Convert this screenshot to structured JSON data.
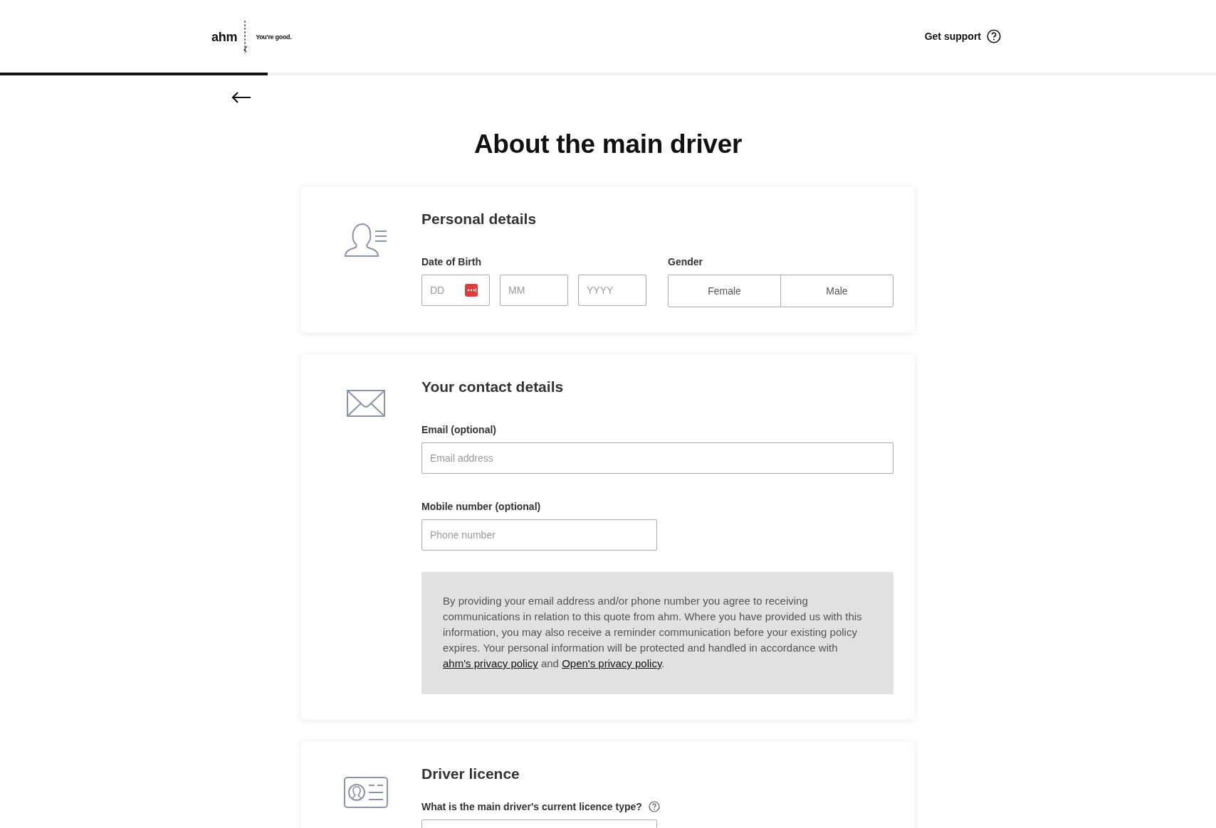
{
  "header": {
    "logo": {
      "brand": "ahm",
      "tagline": "You're good."
    },
    "support_link": "Get support"
  },
  "progress": {
    "level": 0.22
  },
  "title": "About the main driver",
  "sections": [
    {
      "kind": "personal",
      "heading": "Personal details",
      "dob": {
        "label": "Date of Birth",
        "fields": [
          {
            "placeholder": "DD",
            "calendar": true
          },
          {
            "placeholder": "MM",
            "calendar": false
          },
          {
            "placeholder": "YYYY",
            "calendar": false
          }
        ]
      },
      "gender": {
        "label": "Gender",
        "options": [
          {
            "label": "Female",
            "selected": false
          },
          {
            "label": "Male",
            "selected": false
          }
        ]
      }
    },
    {
      "kind": "contact",
      "heading": "Your contact details",
      "email": {
        "label": "Email (optional)",
        "placeholder": "Email address"
      },
      "mobile": {
        "label": "Mobile number (optional)",
        "placeholder": "Phone number"
      },
      "notice": [
        {
          "kind": "text",
          "text": "By providing your email address and/or phone number you agree to receiving communications in relation to this quote from ahm. Where you have provided us with this information, you may also receive a reminder communication before your existing policy expires. Your personal information will be protected and handled in accordance with "
        },
        {
          "kind": "link",
          "text": "ahm's privacy policy"
        },
        {
          "kind": "text",
          "text": " and "
        },
        {
          "kind": "link",
          "text": "Open's privacy policy"
        },
        {
          "kind": "text",
          "text": "."
        }
      ]
    },
    {
      "kind": "licence",
      "heading": "Driver licence",
      "question": "What is the main driver's current licence type?"
    }
  ]
}
